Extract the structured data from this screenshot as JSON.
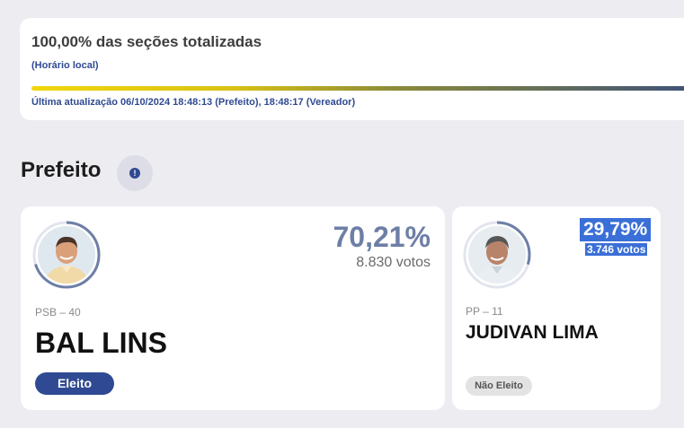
{
  "status": {
    "title": "100,00% das seções totalizadas",
    "timezone_note": "(Horário local)",
    "progress_percent": 100,
    "last_update": "Última atualização 06/10/2024 18:48:13 (Prefeito), 18:48:17 (Vereador)"
  },
  "section": {
    "title": "Prefeito",
    "info_icon": "info-icon"
  },
  "candidates": [
    {
      "percent": "70,21%",
      "votes": "8.830 votos",
      "party": "PSB – 40",
      "name": "BAL LINS",
      "status": "Eleito",
      "ring_fraction": 0.7021
    },
    {
      "percent": "29,79%",
      "votes": "3.746 votos",
      "party": "PP – 11",
      "name": "JUDIVAN LIMA",
      "status": "Não Eleito",
      "ring_fraction": 0.2979
    }
  ],
  "colors": {
    "accent": "#2f4a92",
    "percent_text": "#6d7fa6",
    "progress_start": "#f2d60a",
    "progress_end": "#3e527a",
    "ring": "#6d7fa6",
    "selection": "#3b6fd8"
  }
}
